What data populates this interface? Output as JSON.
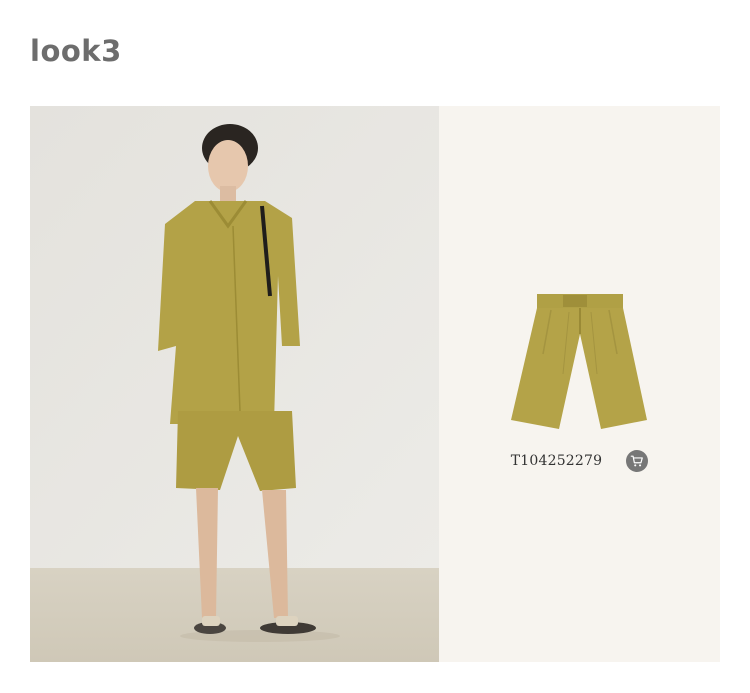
{
  "look": {
    "title": "look3"
  },
  "product": {
    "code": "T104252279",
    "image_icon": "shorts-icon",
    "cart_icon": "cart-icon"
  },
  "colors": {
    "garment": "#b4a348",
    "product_bg": "#f7f4ef",
    "photo_wall": "#e8e6e1",
    "photo_floor": "#d9d3c3",
    "cart_circle": "#777777"
  }
}
